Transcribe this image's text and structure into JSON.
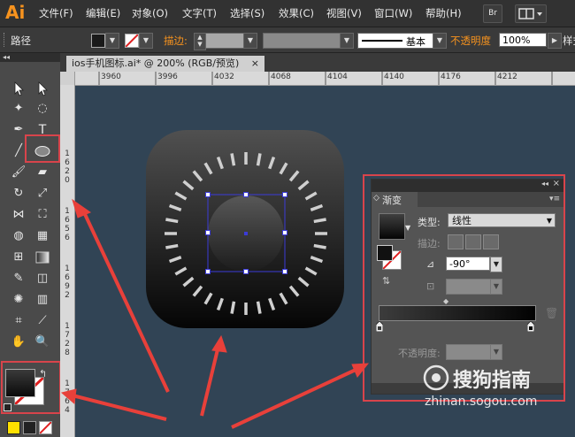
{
  "app": {
    "logo": "Ai"
  },
  "menu": [
    "文件(F)",
    "编辑(E)",
    "对象(O)",
    "文字(T)",
    "选择(S)",
    "效果(C)",
    "视图(V)",
    "窗口(W)",
    "帮助(H)"
  ],
  "menu_buttons": {
    "bridge": "Br"
  },
  "controlbar": {
    "object_label": "路径",
    "stroke_label": "描边:",
    "stroke_style": "基本",
    "opacity_label": "不透明度",
    "opacity_value": "100%",
    "style_label": "样式"
  },
  "document": {
    "tab_title": "ios手机图标.ai* @ 200% (RGB/预览)",
    "close_glyph": "×"
  },
  "ruler": {
    "h_ticks": [
      "3960",
      "3996",
      "4032",
      "4068",
      "4104",
      "4140",
      "4176",
      "4212"
    ],
    "v_ticks": [
      [
        "1",
        "6",
        "2",
        "0"
      ],
      [
        "1",
        "6",
        "5",
        "6"
      ],
      [
        "1",
        "6",
        "9",
        "2"
      ],
      [
        "1",
        "7",
        "2",
        "8"
      ],
      [
        "1",
        "7",
        "6",
        "4"
      ]
    ]
  },
  "gradient_panel": {
    "title": "渐变",
    "type_label": "类型:",
    "type_value": "线性",
    "stroke_label": "描边:",
    "angle_value": "-90°",
    "opacity_label": "不透明度:"
  },
  "watermark": {
    "title": "搜狗指南",
    "url": "zhinan.sogou.com"
  },
  "colors": {
    "canvas": "#314455",
    "highlight": "#d8444b",
    "arrow": "#e8403a",
    "accent": "#f7931e",
    "selection": "#3b3bd8"
  }
}
